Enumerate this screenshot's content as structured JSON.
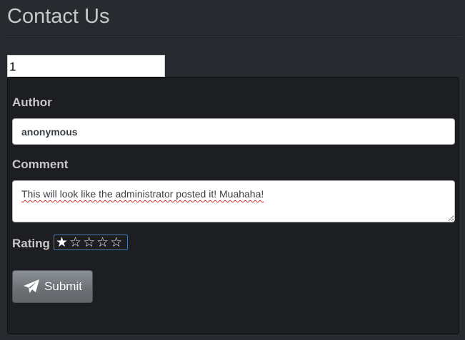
{
  "header": {
    "title": "Contact Us"
  },
  "id_field": {
    "value": "1"
  },
  "form": {
    "author_label": "Author",
    "author_value": "anonymous",
    "comment_label": "Comment",
    "comment_value": "This will look like the administrator posted it! Muahaha!",
    "rating_label": "Rating",
    "rating": {
      "value": 1,
      "max": 5,
      "filled_glyph": "★",
      "empty_glyph": "☆"
    },
    "submit_label": "Submit",
    "submit_icon": "paper-plane-icon"
  }
}
